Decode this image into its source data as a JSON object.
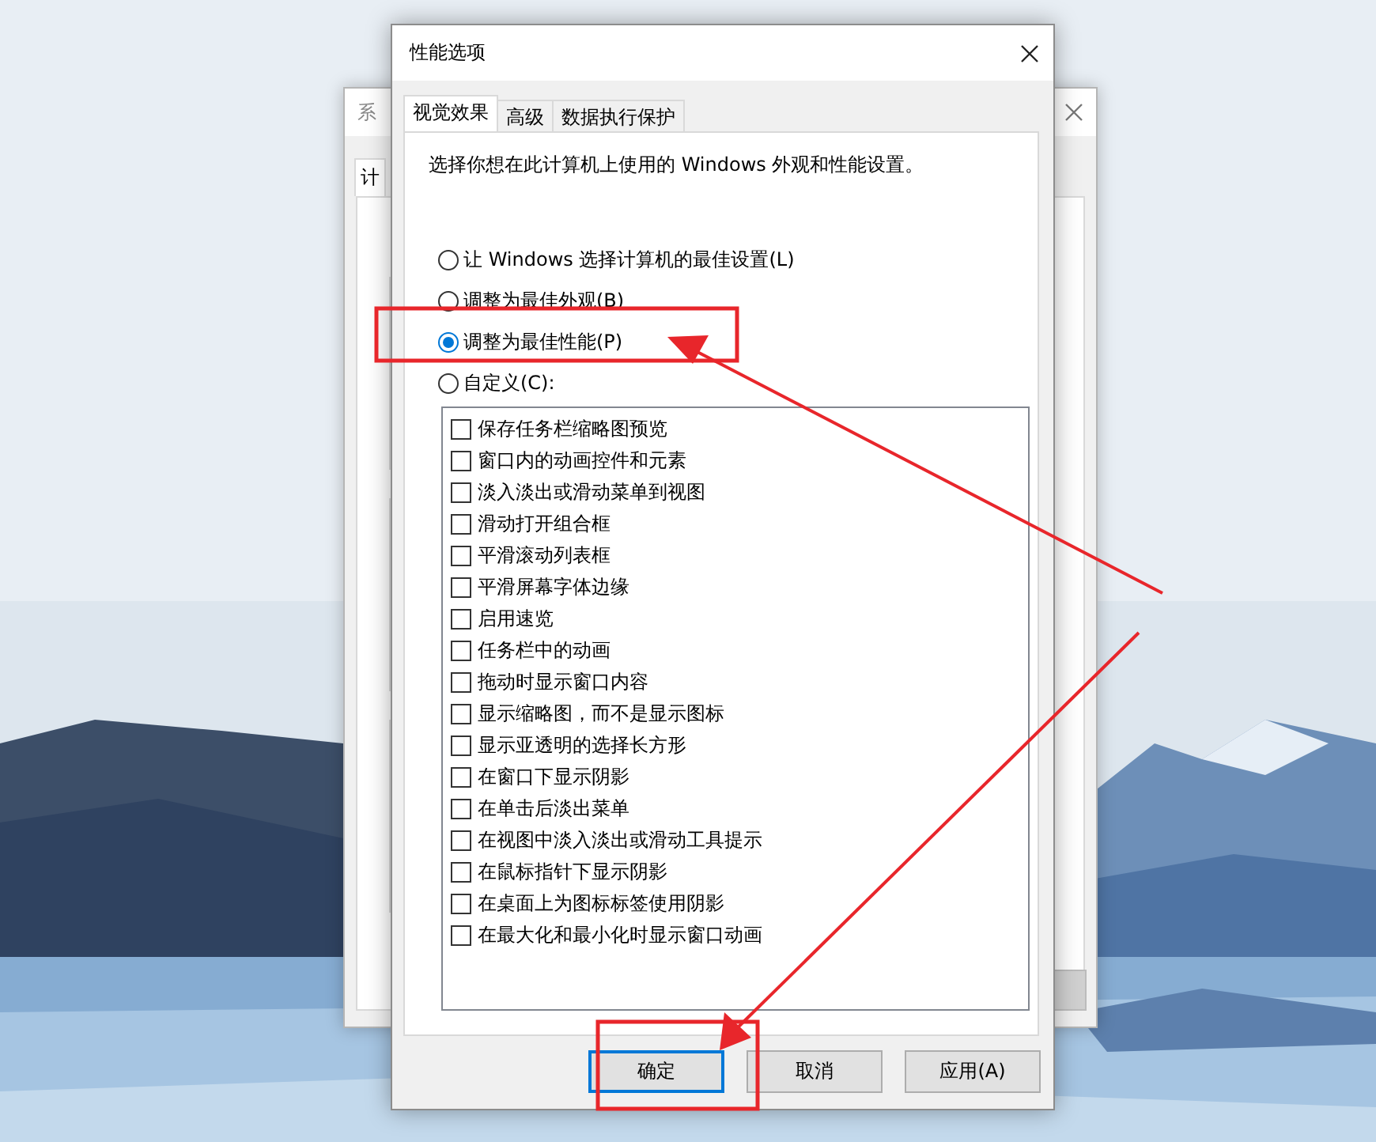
{
  "background_window": {
    "title": "系",
    "tab": "计"
  },
  "dialog": {
    "title": "性能选项",
    "tabs": [
      {
        "label": "视觉效果",
        "selected": true
      },
      {
        "label": "高级",
        "selected": false
      },
      {
        "label": "数据执行保护",
        "selected": false
      }
    ],
    "description": "选择你想在此计算机上使用的 Windows 外观和性能设置。",
    "options": [
      {
        "label": "让 Windows 选择计算机的最佳设置(L)",
        "selected": false
      },
      {
        "label": "调整为最佳外观(B)",
        "selected": false
      },
      {
        "label": "调整为最佳性能(P)",
        "selected": true
      },
      {
        "label": "自定义(C):",
        "selected": false
      }
    ],
    "effects": [
      {
        "label": "保存任务栏缩略图预览",
        "checked": false
      },
      {
        "label": "窗口内的动画控件和元素",
        "checked": false
      },
      {
        "label": "淡入淡出或滑动菜单到视图",
        "checked": false
      },
      {
        "label": "滑动打开组合框",
        "checked": false
      },
      {
        "label": "平滑滚动列表框",
        "checked": false
      },
      {
        "label": "平滑屏幕字体边缘",
        "checked": false
      },
      {
        "label": "启用速览",
        "checked": false
      },
      {
        "label": "任务栏中的动画",
        "checked": false
      },
      {
        "label": "拖动时显示窗口内容",
        "checked": false
      },
      {
        "label": "显示缩略图，而不是显示图标",
        "checked": false
      },
      {
        "label": "显示亚透明的选择长方形",
        "checked": false
      },
      {
        "label": "在窗口下显示阴影",
        "checked": false
      },
      {
        "label": "在单击后淡出菜单",
        "checked": false
      },
      {
        "label": "在视图中淡入淡出或滑动工具提示",
        "checked": false
      },
      {
        "label": "在鼠标指针下显示阴影",
        "checked": false
      },
      {
        "label": "在桌面上为图标标签使用阴影",
        "checked": false
      },
      {
        "label": "在最大化和最小化时显示窗口动画",
        "checked": false
      }
    ],
    "buttons": [
      {
        "label": "确定",
        "default": true
      },
      {
        "label": "取消",
        "default": false
      },
      {
        "label": "应用(A)",
        "default": false
      }
    ]
  }
}
